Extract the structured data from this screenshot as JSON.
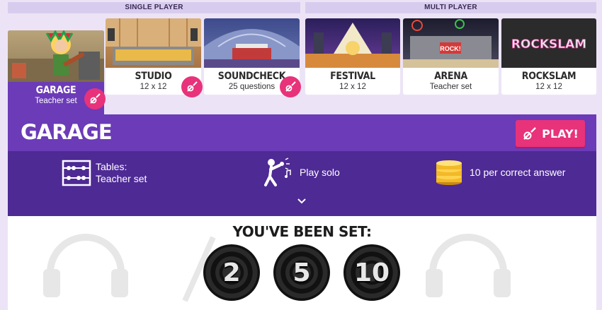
{
  "sections": {
    "single": "SINGLE PLAYER",
    "multi": "MULTI PLAYER"
  },
  "modes": [
    {
      "name": "GARAGE",
      "sub": "Teacher set"
    },
    {
      "name": "STUDIO",
      "sub": "12 x 12"
    },
    {
      "name": "SOUNDCHECK",
      "sub": "25 questions"
    },
    {
      "name": "FESTIVAL",
      "sub": "12 x 12"
    },
    {
      "name": "ARENA",
      "sub": "Teacher set"
    },
    {
      "name": "ROCKSLAM",
      "sub": "12 x 12"
    }
  ],
  "header": {
    "title": "GARAGE",
    "play_label": "PLAY!"
  },
  "info": {
    "tables_label": "Tables:",
    "tables_value": "Teacher set",
    "play_mode": "Play solo",
    "coins": "10 per correct answer"
  },
  "set": {
    "title": "YOU'VE BEEN SET:",
    "tables": [
      "2",
      "5",
      "10"
    ]
  },
  "thumb_signs": {
    "arena": "ROCK!",
    "rockslam": "ROCKSLAM"
  },
  "colors": {
    "purple": "#6b3bb8",
    "dark_purple": "#4e2a94",
    "pink": "#e8327a",
    "bg": "#ece4f6"
  },
  "icons": [
    "guitar-icon",
    "abacus-icon",
    "singer-icon",
    "coins-icon",
    "chevron-down-icon"
  ]
}
